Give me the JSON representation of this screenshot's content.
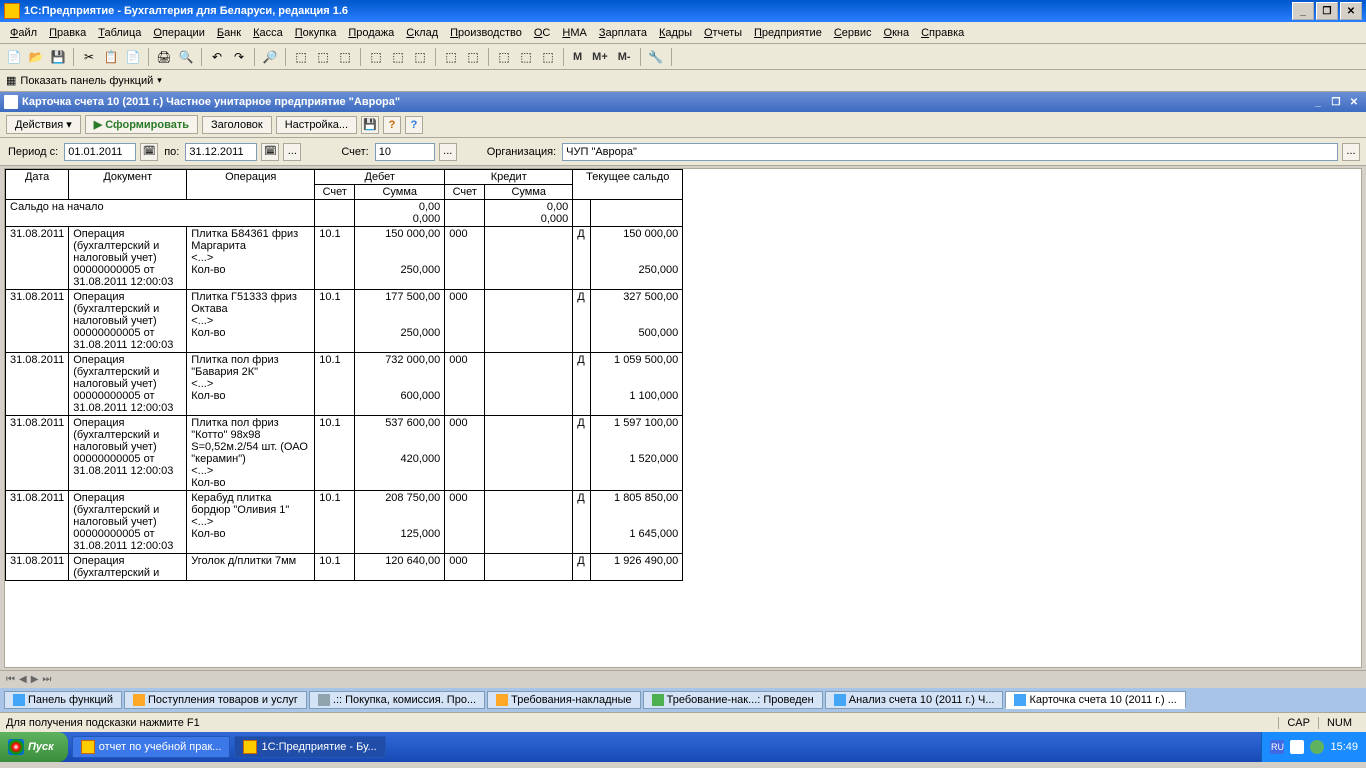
{
  "title": "1С:Предприятие - Бухгалтерия для Беларуси, редакция 1.6",
  "menu": [
    "Файл",
    "Правка",
    "Таблица",
    "Операции",
    "Банк",
    "Касса",
    "Покупка",
    "Продажа",
    "Склад",
    "Производство",
    "ОС",
    "НМА",
    "Зарплата",
    "Кадры",
    "Отчеты",
    "Предприятие",
    "Сервис",
    "Окна",
    "Справка"
  ],
  "funcPanelLabel": "Показать панель функций",
  "mText": {
    "m": "M",
    "mplus": "M+",
    "mminus": "M-"
  },
  "doc": {
    "title": "Карточка счета 10 (2011 г.) Частное унитарное предприятие \"Аврора\"",
    "actions": {
      "actions": "Действия",
      "form": "Сформировать",
      "header": "Заголовок",
      "settings": "Настройка..."
    }
  },
  "filter": {
    "periodFrom": "Период с:",
    "from": "01.01.2011",
    "to_l": "по:",
    "to": "31.12.2011",
    "accLabel": "Счет:",
    "acc": "10",
    "orgLabel": "Организация:",
    "org": "ЧУП \"Аврора\""
  },
  "headers": {
    "date": "Дата",
    "doc": "Документ",
    "op": "Операция",
    "debit": "Дебет",
    "credit": "Кредит",
    "balance": "Текущее сальдо",
    "acc": "Счет",
    "sum": "Сумма"
  },
  "opening": {
    "label": "Сальдо на начало",
    "dsum": "0,00",
    "dsum2": "0,000",
    "csum": "0,00",
    "csum2": "0,000"
  },
  "rows": [
    {
      "date": "31.08.2011",
      "doc": "Операция (бухгалтерский и налоговый учет) 00000000005 от 31.08.2011 12:00:03",
      "op": "Плитка Б84361 фриз Маргарита\n<...>\nКол-во",
      "dacc": "10.1",
      "dsum": "150 000,00",
      "dqty": "250,000",
      "cacc": "000",
      "csum": "",
      "cqty": "",
      "dk": "Д",
      "bal": "150 000,00",
      "balq": "250,000"
    },
    {
      "date": "31.08.2011",
      "doc": "Операция (бухгалтерский и налоговый учет) 00000000005 от 31.08.2011 12:00:03",
      "op": "Плитка Г51333 фриз Октава\n<...>\nКол-во",
      "dacc": "10.1",
      "dsum": "177 500,00",
      "dqty": "250,000",
      "cacc": "000",
      "csum": "",
      "cqty": "",
      "dk": "Д",
      "bal": "327 500,00",
      "balq": "500,000"
    },
    {
      "date": "31.08.2011",
      "doc": "Операция (бухгалтерский и налоговый учет) 00000000005 от 31.08.2011 12:00:03",
      "op": "Плитка пол фриз \"Бавария 2К\"\n<...>\nКол-во",
      "dacc": "10.1",
      "dsum": "732 000,00",
      "dqty": "600,000",
      "cacc": "000",
      "csum": "",
      "cqty": "",
      "dk": "Д",
      "bal": "1 059 500,00",
      "balq": "1 100,000"
    },
    {
      "date": "31.08.2011",
      "doc": "Операция (бухгалтерский и налоговый учет) 00000000005 от 31.08.2011 12:00:03",
      "op": "Плитка пол фриз \"Котто\" 98x98 S=0,52м.2/54 шт. (ОАО \"керамин\")\n<...>\nКол-во",
      "dacc": "10.1",
      "dsum": "537 600,00",
      "dqty": "420,000",
      "cacc": "000",
      "csum": "",
      "cqty": "",
      "dk": "Д",
      "bal": "1 597 100,00",
      "balq": "1 520,000"
    },
    {
      "date": "31.08.2011",
      "doc": "Операция (бухгалтерский и налоговый учет) 00000000005 от 31.08.2011 12:00:03",
      "op": "Керабуд плитка бордюр \"Оливия 1\"\n<...>\nКол-во",
      "dacc": "10.1",
      "dsum": "208 750,00",
      "dqty": "125,000",
      "cacc": "000",
      "csum": "",
      "cqty": "",
      "dk": "Д",
      "bal": "1 805 850,00",
      "balq": "1 645,000"
    },
    {
      "date": "31.08.2011",
      "doc": "Операция (бухгалтерский и",
      "op": "Уголок д/плитки 7мм",
      "dacc": "10.1",
      "dsum": "120 640,00",
      "dqty": "",
      "cacc": "000",
      "csum": "",
      "cqty": "",
      "dk": "Д",
      "bal": "1 926 490,00",
      "balq": ""
    }
  ],
  "mdiTabs": [
    {
      "label": "Панель функций",
      "cls": "i-blue"
    },
    {
      "label": "Поступления товаров и услуг",
      "cls": "i-yellow"
    },
    {
      "label": ".:: Покупка, комиссия. Про...",
      "cls": "i-grey"
    },
    {
      "label": "Требования-накладные",
      "cls": "i-yellow"
    },
    {
      "label": "Требование-нак...: Проведен",
      "cls": "i-green"
    },
    {
      "label": "Анализ счета 10 (2011 г.) Ч...",
      "cls": "i-blue"
    },
    {
      "label": "Карточка счета 10 (2011 г.) ...",
      "cls": "i-blue",
      "active": true
    }
  ],
  "status": {
    "hint": "Для получения подсказки нажмите F1",
    "cap": "CAP",
    "num": "NUM"
  },
  "taskbar": {
    "start": "Пуск",
    "tasks": [
      {
        "label": "отчет по учебной прак..."
      },
      {
        "label": "1С:Предприятие - Бу...",
        "active": true
      }
    ],
    "lang": "RU",
    "clock": "15:49"
  }
}
